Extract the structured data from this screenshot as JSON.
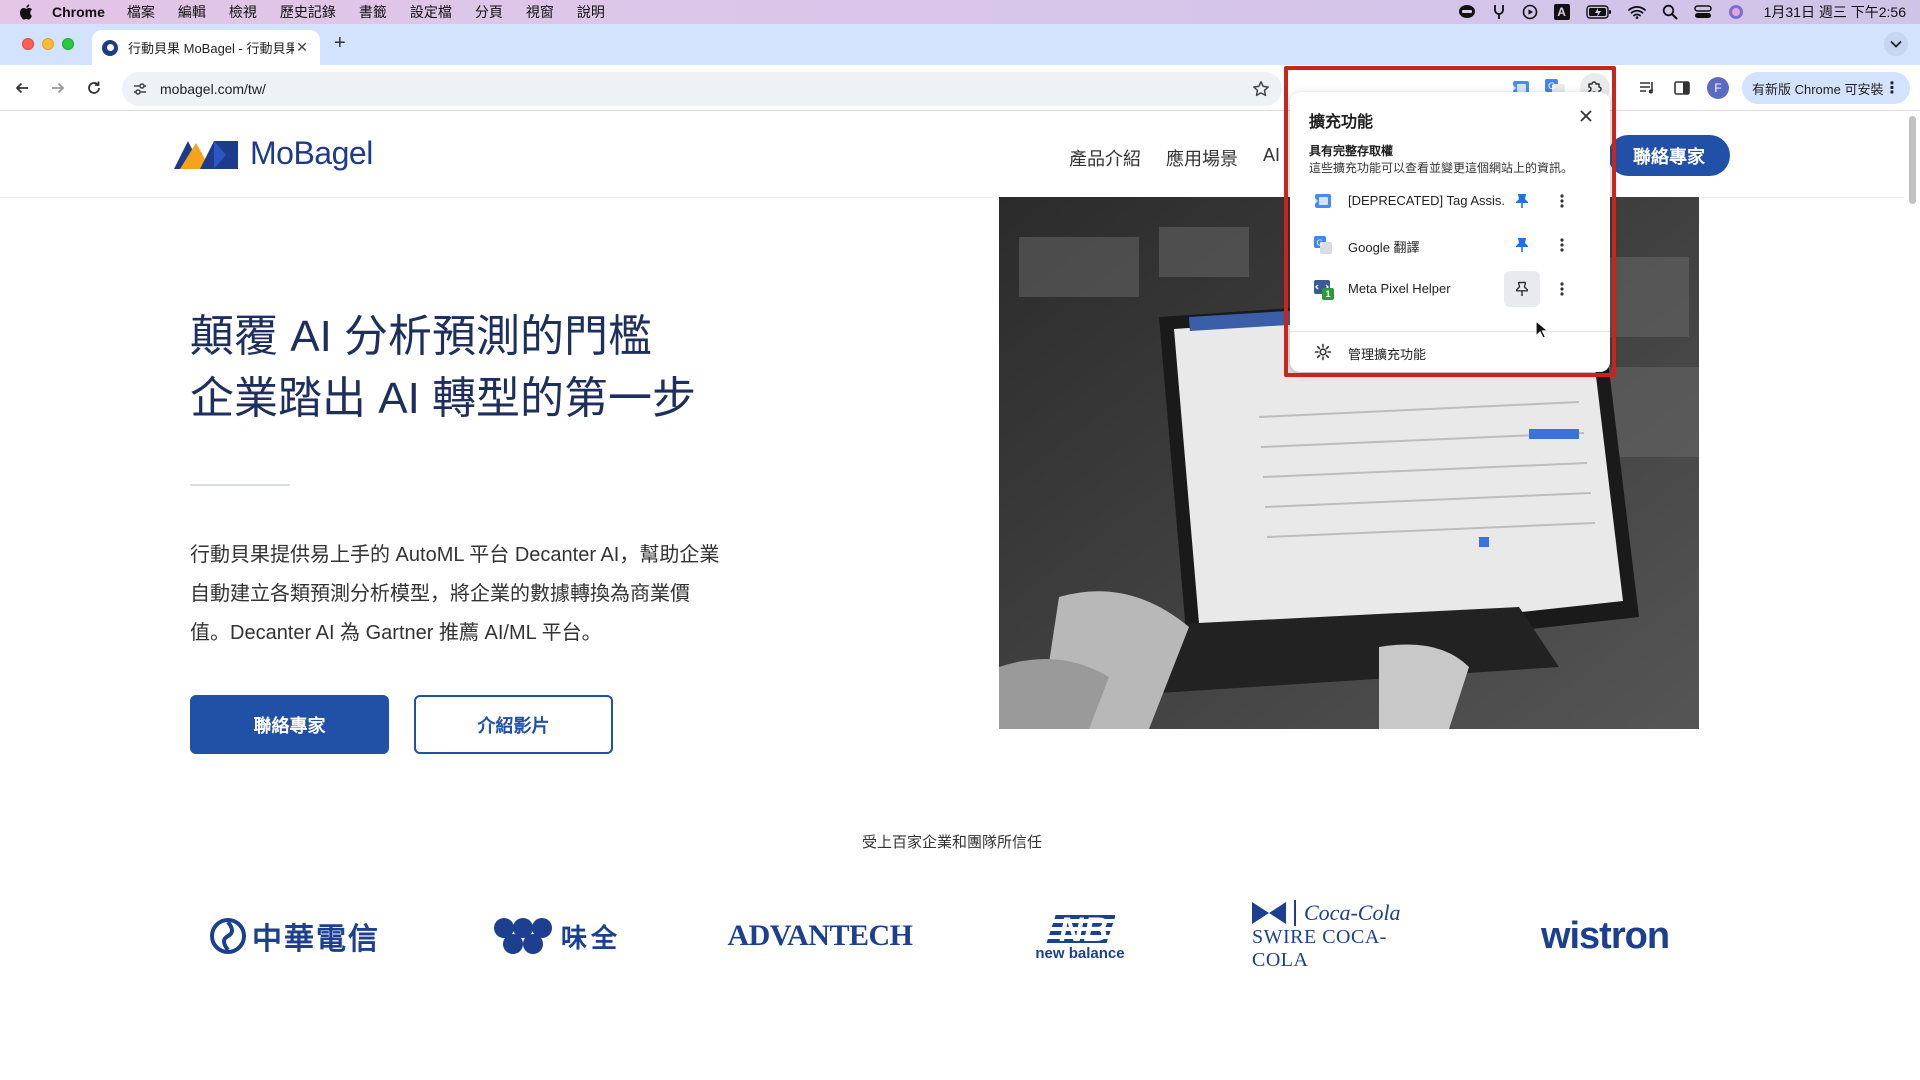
{
  "menubar": {
    "app_name": "Chrome",
    "items": [
      "檔案",
      "編輯",
      "檢視",
      "歷史記錄",
      "書籤",
      "設定檔",
      "分頁",
      "視窗",
      "說明"
    ],
    "input_indicator": "A",
    "clock": "1月31日 週三 下午2:56"
  },
  "tab": {
    "title": "行動貝果 MoBagel - 行動貝果",
    "close_symbol": "✕",
    "new_tab_symbol": "+"
  },
  "toolbar": {
    "url": "mobagel.com/tw/",
    "update_chip_label": "有新版 Chrome 可安裝",
    "profile_initial": "F",
    "menu_symbol": "⋮"
  },
  "site": {
    "logo_text": "MoBagel",
    "nav_items": [
      "產品介紹",
      "應用場景",
      "AI"
    ],
    "header_cta": "聯絡專家",
    "hero_title_line1": "顛覆 AI 分析預測的門檻",
    "hero_title_line2": "企業踏出 AI 轉型的第一步",
    "hero_desc": "行動貝果提供易上手的 AutoML 平台 Decanter AI，幫助企業自動建立各類預測分析模型，將企業的數據轉換為商業價值。Decanter AI 為 Gartner 推薦 AI/ML 平台。",
    "primary_button": "聯絡專家",
    "secondary_button": "介紹影片",
    "trust_text": "受上百家企業和團隊所信任",
    "partners": {
      "cht": "中華電信",
      "weichuan": "味全",
      "advantech": "ADVANTECH",
      "newbalance": "new balance",
      "swire": "SWIRE COCA-COLA",
      "coca_cola": "Coca-Cola",
      "wistron": "wistron"
    }
  },
  "extensions_popup": {
    "title": "擴充功能",
    "close_symbol": "✕",
    "section_title": "具有完整存取權",
    "section_desc": "這些擴充功能可以查看並變更這個網站上的資訊。",
    "items": [
      {
        "name": "[DEPRECATED] Tag Assis...",
        "pinned": true,
        "menu_symbol": "⋮"
      },
      {
        "name": "Google 翻譯",
        "pinned": true,
        "menu_symbol": "⋮"
      },
      {
        "name": "Meta Pixel Helper",
        "pinned": false,
        "badge": "1",
        "menu_symbol": "⋮"
      }
    ],
    "manage_label": "管理擴充功能"
  },
  "colors": {
    "brand_blue": "#2150a7",
    "heading_navy": "#1e2f5e",
    "highlight_red": "#c8261a",
    "pin_blue": "#1a73e8",
    "tabstrip": "#d3e3fd"
  },
  "icons": {
    "menubar": [
      "apple-icon",
      "line-app-icon",
      "fork-icon",
      "play-circle-icon",
      "input-method-icon",
      "battery-icon",
      "wifi-icon",
      "search-icon",
      "control-center-icon",
      "siri-icon"
    ],
    "toolbar": [
      "back-arrow-icon",
      "forward-arrow-icon",
      "reload-icon",
      "site-settings-icon",
      "star-icon",
      "tag-assistant-ext-icon",
      "google-translate-ext-icon",
      "extensions-puzzle-icon",
      "media-controls-icon",
      "side-panel-icon"
    ]
  }
}
